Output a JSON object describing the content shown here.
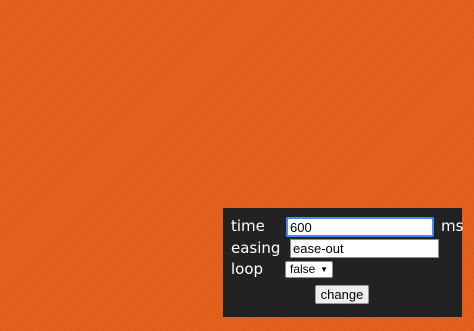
{
  "background": {
    "color": "#e2601c"
  },
  "panel": {
    "background": "#222222",
    "time": {
      "label": "time",
      "value": "600",
      "unit": "ms"
    },
    "easing": {
      "label": "easing",
      "value": "ease-out"
    },
    "loop": {
      "label": "loop",
      "selected": "false",
      "arrow": "▼"
    },
    "change_label": "change"
  }
}
